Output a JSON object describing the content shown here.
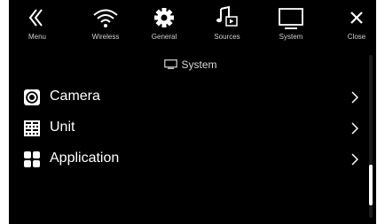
{
  "topbar": {
    "items": [
      {
        "label": "Menu",
        "icon": "menu-double-chevron-icon"
      },
      {
        "label": "Wireless",
        "icon": "wifi-icon"
      },
      {
        "label": "General",
        "icon": "gear-icon"
      },
      {
        "label": "Sources",
        "icon": "music-note-icon"
      },
      {
        "label": "System",
        "icon": "monitor-icon"
      },
      {
        "label": "Close",
        "icon": "close-icon"
      }
    ]
  },
  "page": {
    "title": "System",
    "title_icon": "monitor-icon"
  },
  "list": {
    "items": [
      {
        "label": "Camera",
        "icon": "camera-lens-icon"
      },
      {
        "label": "Unit",
        "icon": "unit-grid-icon"
      },
      {
        "label": "Application",
        "icon": "app-grid-icon"
      }
    ]
  },
  "scroll": {
    "position_fraction": 0.85
  },
  "colors": {
    "background": "#000000",
    "text": "#ffffff",
    "label_muted": "#cfcfcf"
  }
}
